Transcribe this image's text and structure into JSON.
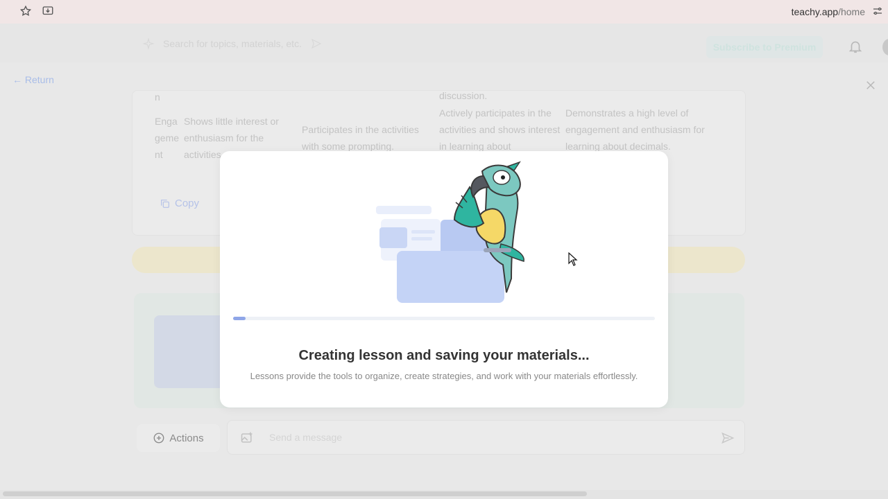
{
  "browser": {
    "url_host": "teachy.app",
    "url_path": "/home"
  },
  "header": {
    "search_placeholder": "Search for topics, materials, etc.",
    "subscribe_label": "Subscribe to Premium"
  },
  "page": {
    "return_label": "Return",
    "table_rows": [
      {
        "criterion": "Enga geme nt",
        "col1": "Shows little interest or enthusiasm for the activities.",
        "col2": "Participates in the activities with some prompting.",
        "col3": "Actively participates in the activities and shows interest in learning about",
        "col4": "Demonstrates a high level of engagement and enthusiasm for learning about decimals."
      }
    ],
    "fragment_n": "n",
    "fragment_discussion": "discussion.",
    "copy_label": "Copy",
    "actions_label": "Actions",
    "message_placeholder": "Send a message"
  },
  "modal": {
    "title": "Creating lesson and saving your materials...",
    "description": "Lessons provide the tools to organize, create strategies, and work with your materials effortlessly.",
    "progress_percent": 3
  },
  "colors": {
    "accent_blue": "#8fa6e8",
    "parrot_teal": "#7cc8c0",
    "parrot_green": "#2fb5a0",
    "parrot_yellow": "#f5d867"
  }
}
